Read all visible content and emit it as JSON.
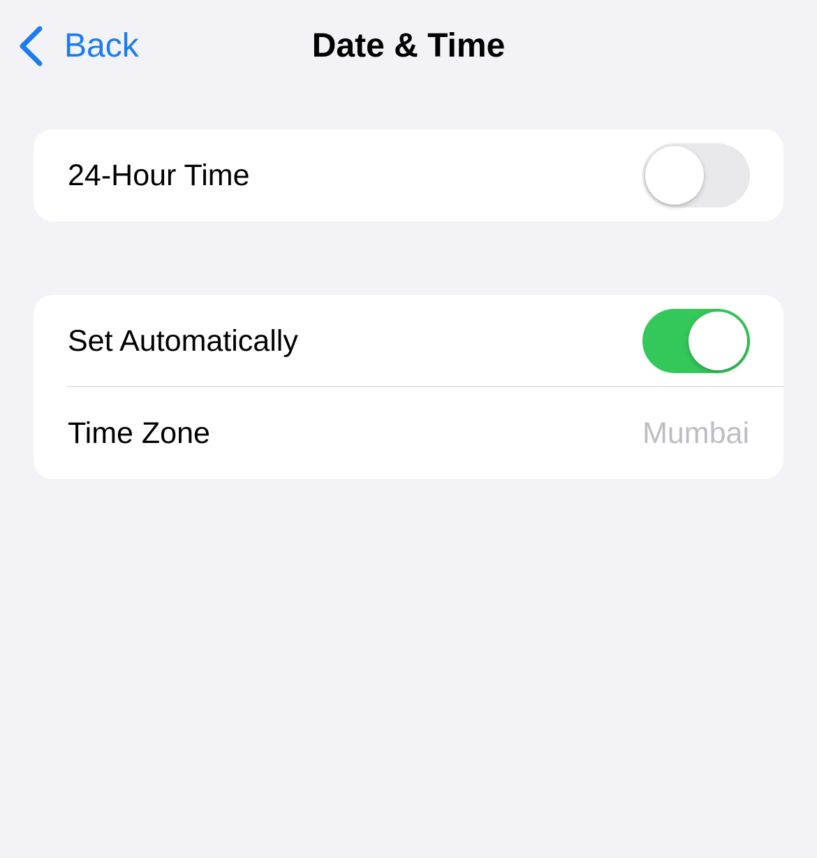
{
  "nav": {
    "back_label": "Back",
    "title": "Date & Time"
  },
  "settings": {
    "hour24": {
      "label": "24-Hour Time",
      "enabled": false
    },
    "set_automatically": {
      "label": "Set Automatically",
      "enabled": true
    },
    "time_zone": {
      "label": "Time Zone",
      "value": "Mumbai"
    }
  },
  "colors": {
    "accent": "#1a7cf0",
    "toggle_on": "#34c759",
    "toggle_off": "#e9e9eb",
    "background": "#f2f2f7",
    "secondary_text": "#bdbdc2"
  },
  "icons": {
    "back": "chevron-left-icon"
  }
}
